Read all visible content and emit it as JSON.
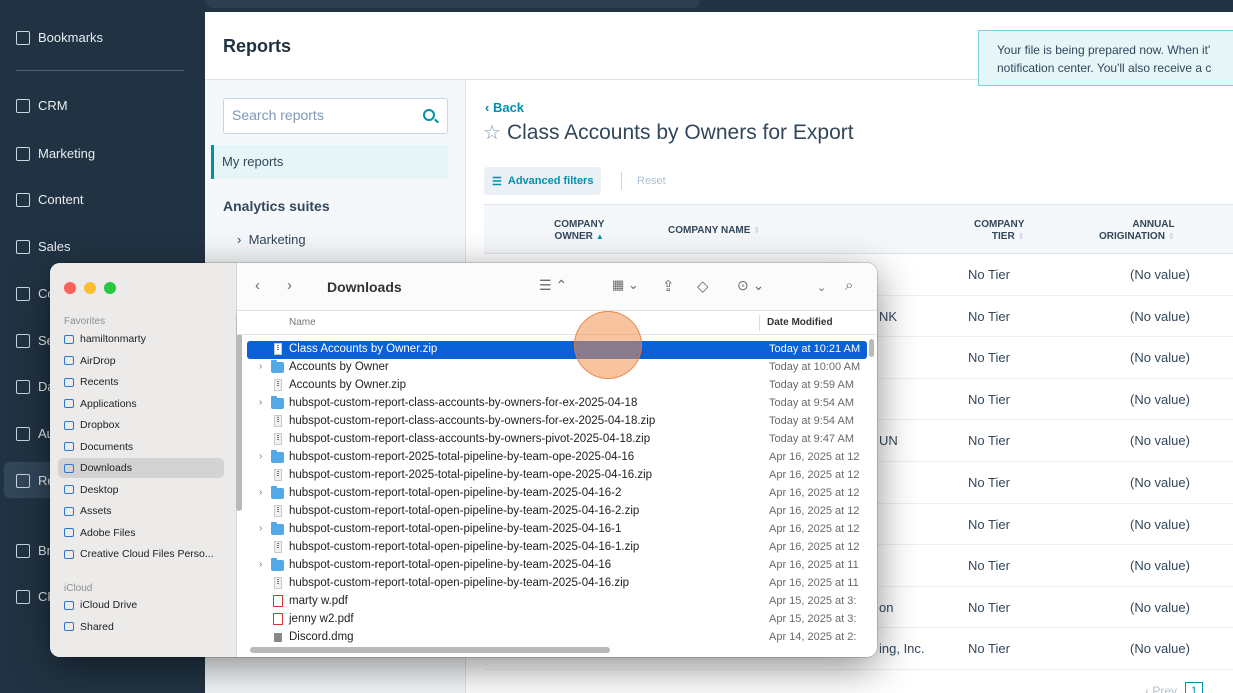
{
  "nav": {
    "items": [
      {
        "label": "Bookmarks",
        "icon": "bookmark-icon"
      },
      {
        "label": "CRM",
        "icon": "crm-icon"
      },
      {
        "label": "Marketing",
        "icon": "megaphone-icon"
      },
      {
        "label": "Content",
        "icon": "content-icon"
      },
      {
        "label": "Sales",
        "icon": "sales-icon"
      },
      {
        "label": "Co",
        "icon": "commerce-icon"
      },
      {
        "label": "Se",
        "icon": "service-icon"
      },
      {
        "label": "Da",
        "icon": "database-icon"
      },
      {
        "label": "Au",
        "icon": "automation-icon"
      },
      {
        "label": "Re",
        "icon": "reporting-icon"
      },
      {
        "label": "Br",
        "icon": "breeze-icon"
      },
      {
        "label": "CF",
        "icon": "cms-icon"
      }
    ]
  },
  "reports": {
    "title": "Reports",
    "toast_line1": "Your file is being prepared now. When it'",
    "toast_line2": "notification center. You'll also receive a c",
    "search_placeholder": "Search reports",
    "my_reports": "My reports",
    "suites_heading": "Analytics suites",
    "suite_item": "Marketing",
    "back": "Back",
    "report_title": "Class Accounts by Owners for Export",
    "advanced_filters": "Advanced filters",
    "reset": "Reset",
    "columns": {
      "owner": "COMPANY\nOWNER",
      "name": "COMPANY NAME",
      "tier": "COMPANY\nTIER",
      "annual": "ANNUAL\nORIGINATION"
    },
    "rows": [
      {
        "name": "",
        "tier": "No Tier",
        "annual": "(No value)"
      },
      {
        "name": "NK",
        "tier": "No Tier",
        "annual": "(No value)"
      },
      {
        "name": "",
        "tier": "No Tier",
        "annual": "(No value)"
      },
      {
        "name": "",
        "tier": "No Tier",
        "annual": "(No value)"
      },
      {
        "name": "UN",
        "tier": "No Tier",
        "annual": "(No value)"
      },
      {
        "name": "",
        "tier": "No Tier",
        "annual": "(No value)"
      },
      {
        "name": "",
        "tier": "No Tier",
        "annual": "(No value)"
      },
      {
        "name": "",
        "tier": "No Tier",
        "annual": "(No value)"
      },
      {
        "name": "on",
        "tier": "No Tier",
        "annual": "(No value)"
      },
      {
        "name": "ing, Inc.",
        "tier": "No Tier",
        "annual": "(No value)"
      }
    ],
    "pager_prev": "Prev",
    "pager_page": "1"
  },
  "finder": {
    "title": "Downloads",
    "sidebar": {
      "favorites_heading": "Favorites",
      "favorites": [
        {
          "label": "hamiltonmarty",
          "icon": "home-icon"
        },
        {
          "label": "AirDrop",
          "icon": "airdrop-icon"
        },
        {
          "label": "Recents",
          "icon": "clock-icon"
        },
        {
          "label": "Applications",
          "icon": "applications-icon"
        },
        {
          "label": "Dropbox",
          "icon": "folder-icon"
        },
        {
          "label": "Documents",
          "icon": "document-icon"
        },
        {
          "label": "Downloads",
          "icon": "download-icon"
        },
        {
          "label": "Desktop",
          "icon": "desktop-icon"
        },
        {
          "label": "Assets",
          "icon": "folder-icon"
        },
        {
          "label": "Adobe Files",
          "icon": "adobe-icon"
        },
        {
          "label": "Creative Cloud Files Perso...",
          "icon": "folder-icon"
        }
      ],
      "icloud_heading": "iCloud",
      "icloud": [
        {
          "label": "iCloud Drive",
          "icon": "cloud-icon"
        },
        {
          "label": "Shared",
          "icon": "shared-folder-icon"
        }
      ]
    },
    "col_name": "Name",
    "col_date": "Date Modified",
    "files": [
      {
        "name": "Class Accounts by Owner.zip",
        "date": "Today at 10:21 AM",
        "type": "zip",
        "expand": ""
      },
      {
        "name": "Accounts by Owner",
        "date": "Today at 10:00 AM",
        "type": "folder",
        "expand": "›"
      },
      {
        "name": "Accounts by Owner.zip",
        "date": "Today at 9:59 AM",
        "type": "zip",
        "expand": ""
      },
      {
        "name": "hubspot-custom-report-class-accounts-by-owners-for-ex-2025-04-18",
        "date": "Today at 9:54 AM",
        "type": "folder",
        "expand": "›"
      },
      {
        "name": "hubspot-custom-report-class-accounts-by-owners-for-ex-2025-04-18.zip",
        "date": "Today at 9:54 AM",
        "type": "zip",
        "expand": ""
      },
      {
        "name": "hubspot-custom-report-class-accounts-by-owners-pivot-2025-04-18.zip",
        "date": "Today at 9:47 AM",
        "type": "zip",
        "expand": ""
      },
      {
        "name": "hubspot-custom-report-2025-total-pipeline-by-team-ope-2025-04-16",
        "date": "Apr 16, 2025 at 12",
        "type": "folder",
        "expand": "›"
      },
      {
        "name": "hubspot-custom-report-2025-total-pipeline-by-team-ope-2025-04-16.zip",
        "date": "Apr 16, 2025 at 12",
        "type": "zip",
        "expand": ""
      },
      {
        "name": "hubspot-custom-report-total-open-pipeline-by-team-2025-04-16-2",
        "date": "Apr 16, 2025 at 12",
        "type": "folder",
        "expand": "›"
      },
      {
        "name": "hubspot-custom-report-total-open-pipeline-by-team-2025-04-16-2.zip",
        "date": "Apr 16, 2025 at 12",
        "type": "zip",
        "expand": ""
      },
      {
        "name": "hubspot-custom-report-total-open-pipeline-by-team-2025-04-16-1",
        "date": "Apr 16, 2025 at 12",
        "type": "folder",
        "expand": "›"
      },
      {
        "name": "hubspot-custom-report-total-open-pipeline-by-team-2025-04-16-1.zip",
        "date": "Apr 16, 2025 at 12",
        "type": "zip",
        "expand": ""
      },
      {
        "name": "hubspot-custom-report-total-open-pipeline-by-team-2025-04-16",
        "date": "Apr 16, 2025 at 11",
        "type": "folder",
        "expand": "›"
      },
      {
        "name": "hubspot-custom-report-total-open-pipeline-by-team-2025-04-16.zip",
        "date": "Apr 16, 2025 at 11",
        "type": "zip",
        "expand": ""
      },
      {
        "name": "marty w.pdf",
        "date": "Apr 15, 2025 at 3:",
        "type": "pdf",
        "expand": ""
      },
      {
        "name": "jenny w2.pdf",
        "date": "Apr 15, 2025 at 3:",
        "type": "pdf",
        "expand": ""
      },
      {
        "name": "Discord.dmg",
        "date": "Apr 14, 2025 at 2:",
        "type": "dmg",
        "expand": ""
      }
    ]
  }
}
